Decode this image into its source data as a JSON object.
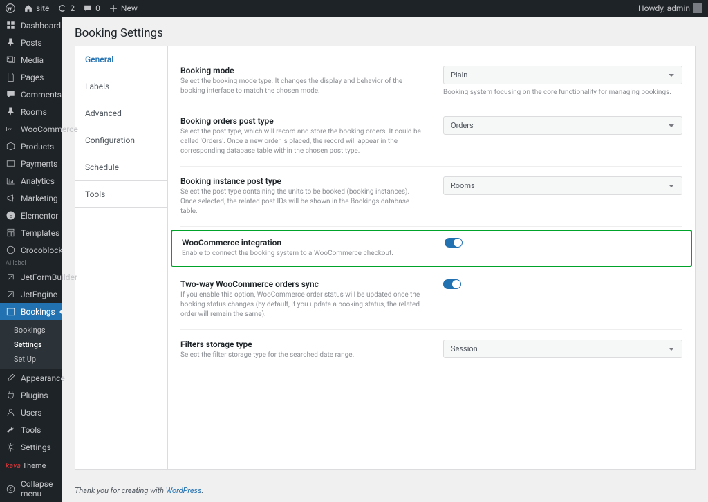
{
  "adminbar": {
    "site": "site",
    "updates": "2",
    "comments": "0",
    "new": "New",
    "howdy": "Howdy, admin"
  },
  "sidebar": {
    "items": [
      {
        "label": "Dashboard",
        "icon": "dash"
      },
      {
        "label": "Posts",
        "icon": "pin"
      },
      {
        "label": "Media",
        "icon": "media"
      },
      {
        "label": "Pages",
        "icon": "page"
      },
      {
        "label": "Comments",
        "icon": "comment"
      },
      {
        "label": "Rooms",
        "icon": "pin"
      },
      {
        "label": "WooCommerce",
        "icon": "woo"
      },
      {
        "label": "Products",
        "icon": "box"
      },
      {
        "label": "Payments",
        "icon": "card",
        "badge": true
      },
      {
        "label": "Analytics",
        "icon": "chart"
      },
      {
        "label": "Marketing",
        "icon": "mega"
      },
      {
        "label": "Elementor",
        "icon": "e"
      },
      {
        "label": "Templates",
        "icon": "tmpl"
      },
      {
        "label": "Crocoblock",
        "icon": "croco"
      },
      {
        "label": "JetFormBuilder",
        "icon": "jet"
      },
      {
        "label": "JetEngine",
        "icon": "jet"
      },
      {
        "label": "Bookings",
        "icon": "cal",
        "active": true
      },
      {
        "label": "Appearance",
        "icon": "brush"
      },
      {
        "label": "Plugins",
        "icon": "plug"
      },
      {
        "label": "Users",
        "icon": "user"
      },
      {
        "label": "Tools",
        "icon": "wrench"
      },
      {
        "label": "Settings",
        "icon": "gear"
      }
    ],
    "ai_label": "AI label",
    "submenu": [
      "Bookings",
      "Settings",
      "Set Up"
    ],
    "submenu_active": "Settings",
    "kava_pre": "kava",
    "kava_post": "Theme",
    "collapse": "Collapse menu"
  },
  "page": {
    "title": "Booking Settings",
    "tabs": [
      "General",
      "Labels",
      "Advanced",
      "Configuration",
      "Schedule",
      "Tools"
    ],
    "active_tab": "General"
  },
  "settings": [
    {
      "title": "Booking mode",
      "desc": "Select the booking mode type. It changes the display and behavior of the booking interface to match the chosen mode.",
      "type": "select",
      "value": "Plain",
      "help": "Booking system focusing on the core functionality for managing bookings."
    },
    {
      "title": "Booking orders post type",
      "desc": "Select the post type, which will record and store the booking orders. It could be called 'Orders'. Once a new order is placed, the record will appear in the corresponding database table within the chosen post type.",
      "type": "select",
      "value": "Orders"
    },
    {
      "title": "Booking instance post type",
      "desc": "Select the post type containing the units to be booked (booking instances). Once selected, the related post IDs will be shown in the Bookings database table.",
      "type": "select",
      "value": "Rooms"
    },
    {
      "title": "WooCommerce integration",
      "desc": "Enable to connect the booking system to a WooCommerce checkout.",
      "type": "toggle",
      "highlight": true
    },
    {
      "title": "Two-way WooCommerce orders sync",
      "desc": "If you enable this option, WooCommerce order status will be updated once the booking status changes (by default, if you update a booking status, the related order will remain the same).",
      "type": "toggle"
    },
    {
      "title": "Filters storage type",
      "desc": "Select the filter storage type for the searched date range.",
      "type": "select",
      "value": "Session"
    }
  ],
  "footer": {
    "text": "Thank you for creating with ",
    "link": "WordPress"
  }
}
